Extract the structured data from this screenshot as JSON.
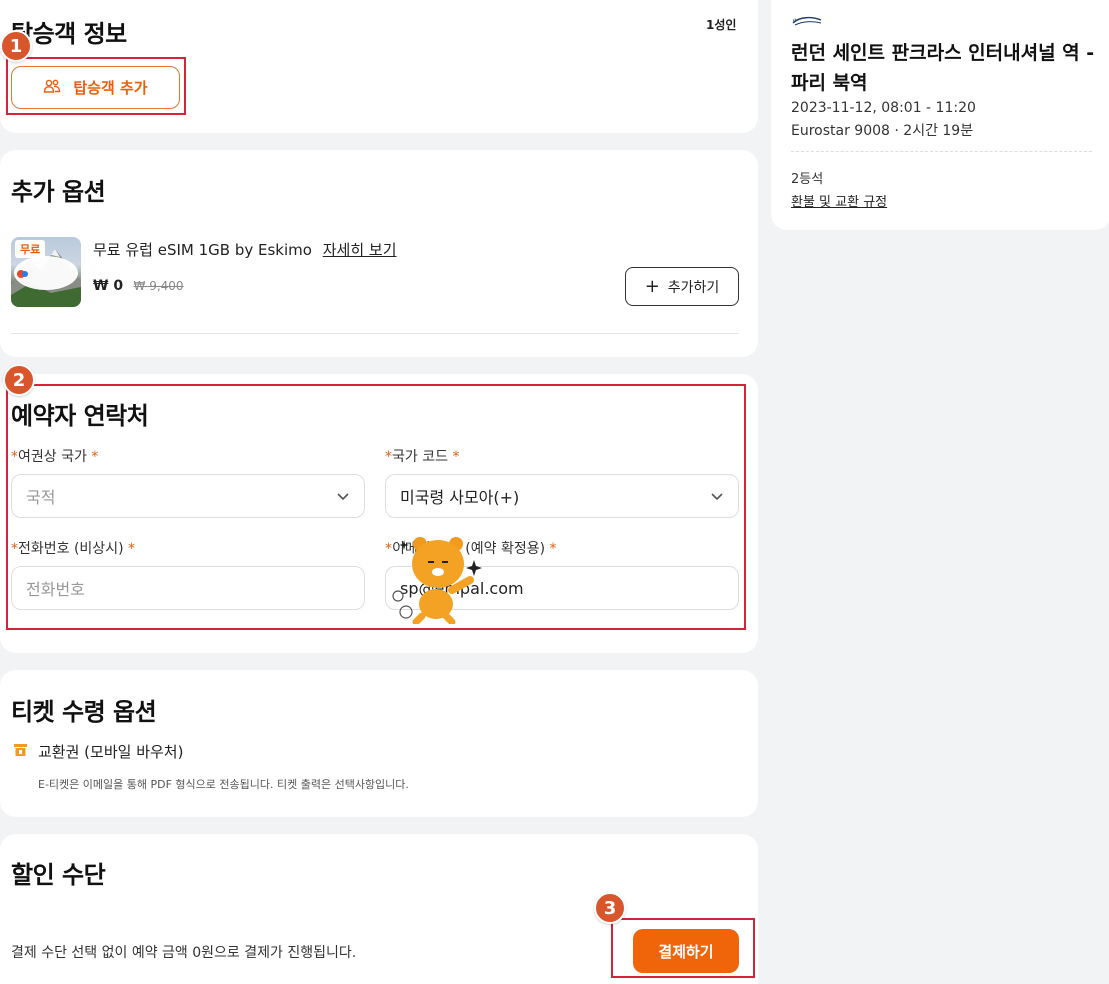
{
  "passenger": {
    "title": "탑승객 정보",
    "count": "1성인",
    "add_button": "탑승객 추가"
  },
  "extras": {
    "title": "추가 옵션",
    "thumb_badge": "무료",
    "item_name": "무료 유럽 eSIM 1GB by Eskimo",
    "details_link": "자세히 보기",
    "price": "₩ 0",
    "original_price": "₩ 9,400",
    "add_button": "추가하기"
  },
  "contact": {
    "title": "예약자 연락처",
    "nationality_label": "여권상 국가",
    "nationality_placeholder": "국적",
    "country_code_label": "국가 코드",
    "country_code_value": "미국령 사모아(+)",
    "phone_label": "전화번호 (비상시)",
    "phone_placeholder": "전화번호",
    "email_label": "이메일 주소 (예약 확정용)",
    "email_value": "sp@empal.com"
  },
  "ticket": {
    "title": "티켓 수령 옵션",
    "option": "교환권 (모바일 바우처)",
    "note": "E-티켓은 이메일을 통해 PDF 형식으로 전송됩니다. 티켓 출력은 선택사항입니다."
  },
  "discount": {
    "title": "할인 수단",
    "note": "결제 수단 선택 없이 예약 금액 0원으로 결제가 진행됩니다.",
    "pay_button": "결제하기"
  },
  "summary": {
    "route": "런던 세인트 판크라스 인터내셔널 역 - 파리 북역",
    "datetime": "2023-11-12, 08:01 - 11:20",
    "train": "Eurostar 9008 · 2시간 19분",
    "seat_class": "2등석",
    "policy_link": "환불 및 교환 규정"
  },
  "annotations": [
    "1",
    "2",
    "3"
  ],
  "colors": {
    "accent": "#f0640a",
    "annotation": "#d6223a",
    "badge": "#d9562c"
  }
}
